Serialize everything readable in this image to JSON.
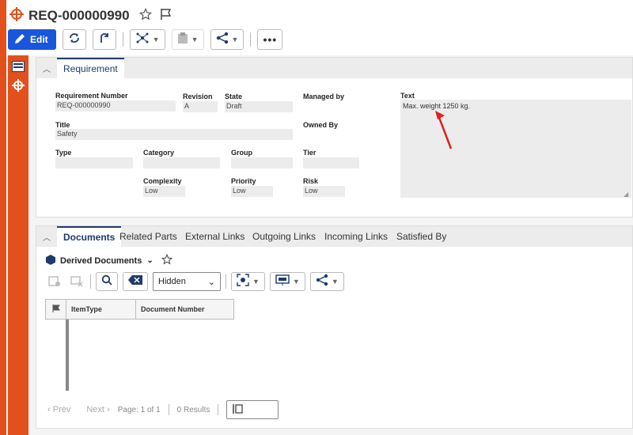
{
  "header": {
    "title": "REQ-000000990",
    "edit_label": "Edit"
  },
  "colors": {
    "accent": "#e2501d",
    "primary": "#1a56db",
    "tab_active": "#1f3a6d"
  },
  "panel1": {
    "tab_label": "Requirement",
    "fields": {
      "req_number_label": "Requirement Number",
      "req_number_value": "REQ-000000990",
      "revision_label": "Revision",
      "revision_value": "A",
      "state_label": "State",
      "state_value": "Draft",
      "managed_by_label": "Managed by",
      "title_label": "Title",
      "title_value": "Safety",
      "owned_by_label": "Owned By",
      "type_label": "Type",
      "category_label": "Category",
      "group_label": "Group",
      "tier_label": "Tier",
      "complexity_label": "Complexity",
      "complexity_value": "Low",
      "priority_label": "Priority",
      "priority_value": "Low",
      "risk_label": "Risk",
      "risk_value": "Low",
      "text_label": "Text",
      "text_value": "Max. weight 1250 kg."
    }
  },
  "panel2": {
    "tabs": [
      "Documents",
      "Related Parts",
      "External Links",
      "Outgoing Links",
      "Incoming Links",
      "Satisfied By"
    ],
    "sub_title": "Derived Documents",
    "filter_value": "Hidden",
    "grid_headers": [
      "ItemType",
      "Document Number"
    ],
    "pager": {
      "prev": "Prev",
      "next": "Next",
      "page": "Page: 1 of 1",
      "results": "0 Results"
    }
  }
}
